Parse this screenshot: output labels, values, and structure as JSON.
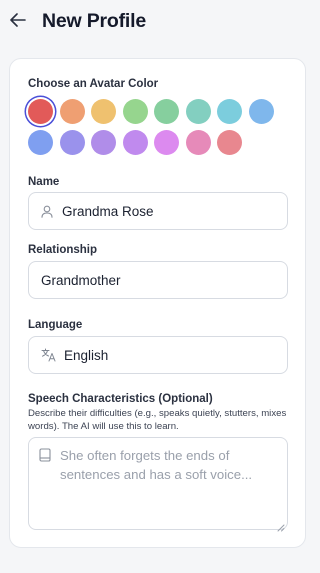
{
  "header": {
    "title": "New Profile"
  },
  "avatar": {
    "label": "Choose an Avatar Color",
    "selected_index": 0,
    "colors": [
      "#e25a59",
      "#ef9f72",
      "#efc16f",
      "#96d58e",
      "#86cf9e",
      "#83cfc0",
      "#7ccddd",
      "#7fb7ec",
      "#7f9ff0",
      "#9a92ec",
      "#b08de9",
      "#c08aee",
      "#dc8aef",
      "#e68ab9",
      "#e8878f"
    ]
  },
  "name": {
    "label": "Name",
    "value": "Grandma Rose"
  },
  "relationship": {
    "label": "Relationship",
    "value": "Grandmother"
  },
  "language": {
    "label": "Language",
    "value": "English"
  },
  "speech": {
    "label": "Speech Characteristics (Optional)",
    "helper": "Describe their difficulties (e.g., speaks quietly, stutters, mixes words). The AI will use this to learn.",
    "placeholder": "She often forgets the ends of sentences and has a soft voice..."
  }
}
